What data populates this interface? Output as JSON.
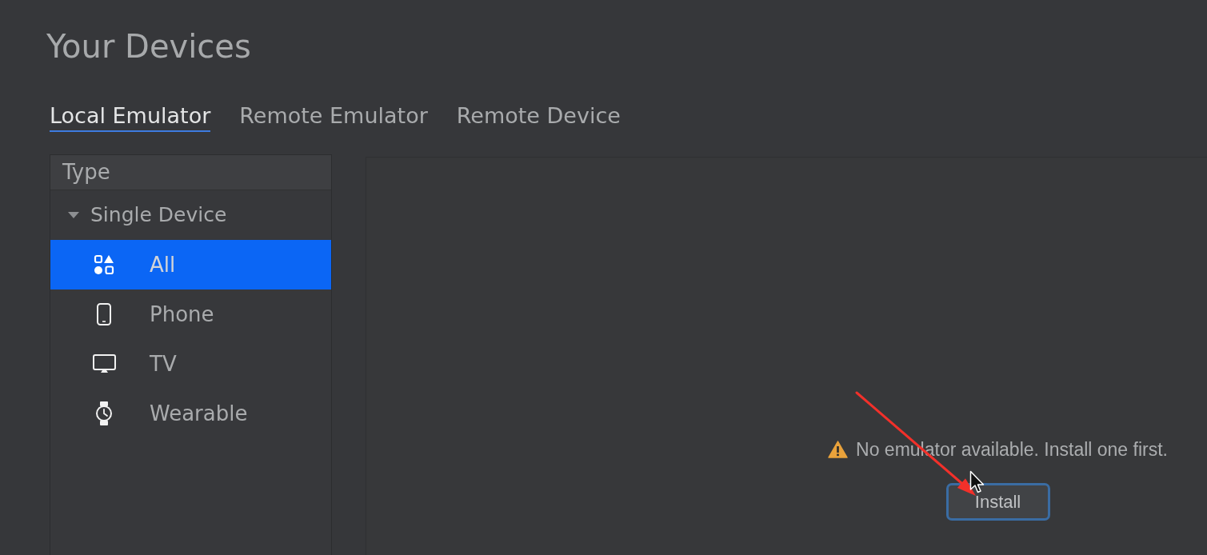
{
  "page": {
    "title": "Your Devices"
  },
  "tabs": [
    {
      "label": "Local Emulator",
      "selected": true
    },
    {
      "label": "Remote Emulator",
      "selected": false
    },
    {
      "label": "Remote Device",
      "selected": false
    }
  ],
  "sidebar": {
    "header": "Type",
    "groups": [
      {
        "label": "Single Device",
        "expanded": true,
        "children": [
          {
            "label": "All",
            "kind": "all",
            "selected": true
          },
          {
            "label": "Phone",
            "kind": "phone",
            "selected": false
          },
          {
            "label": "TV",
            "kind": "tv",
            "selected": false
          },
          {
            "label": "Wearable",
            "kind": "wearable",
            "selected": false
          }
        ]
      }
    ]
  },
  "main": {
    "message": "No emulator available. Install one first.",
    "install_button": {
      "label": "Install",
      "focused": true
    }
  }
}
